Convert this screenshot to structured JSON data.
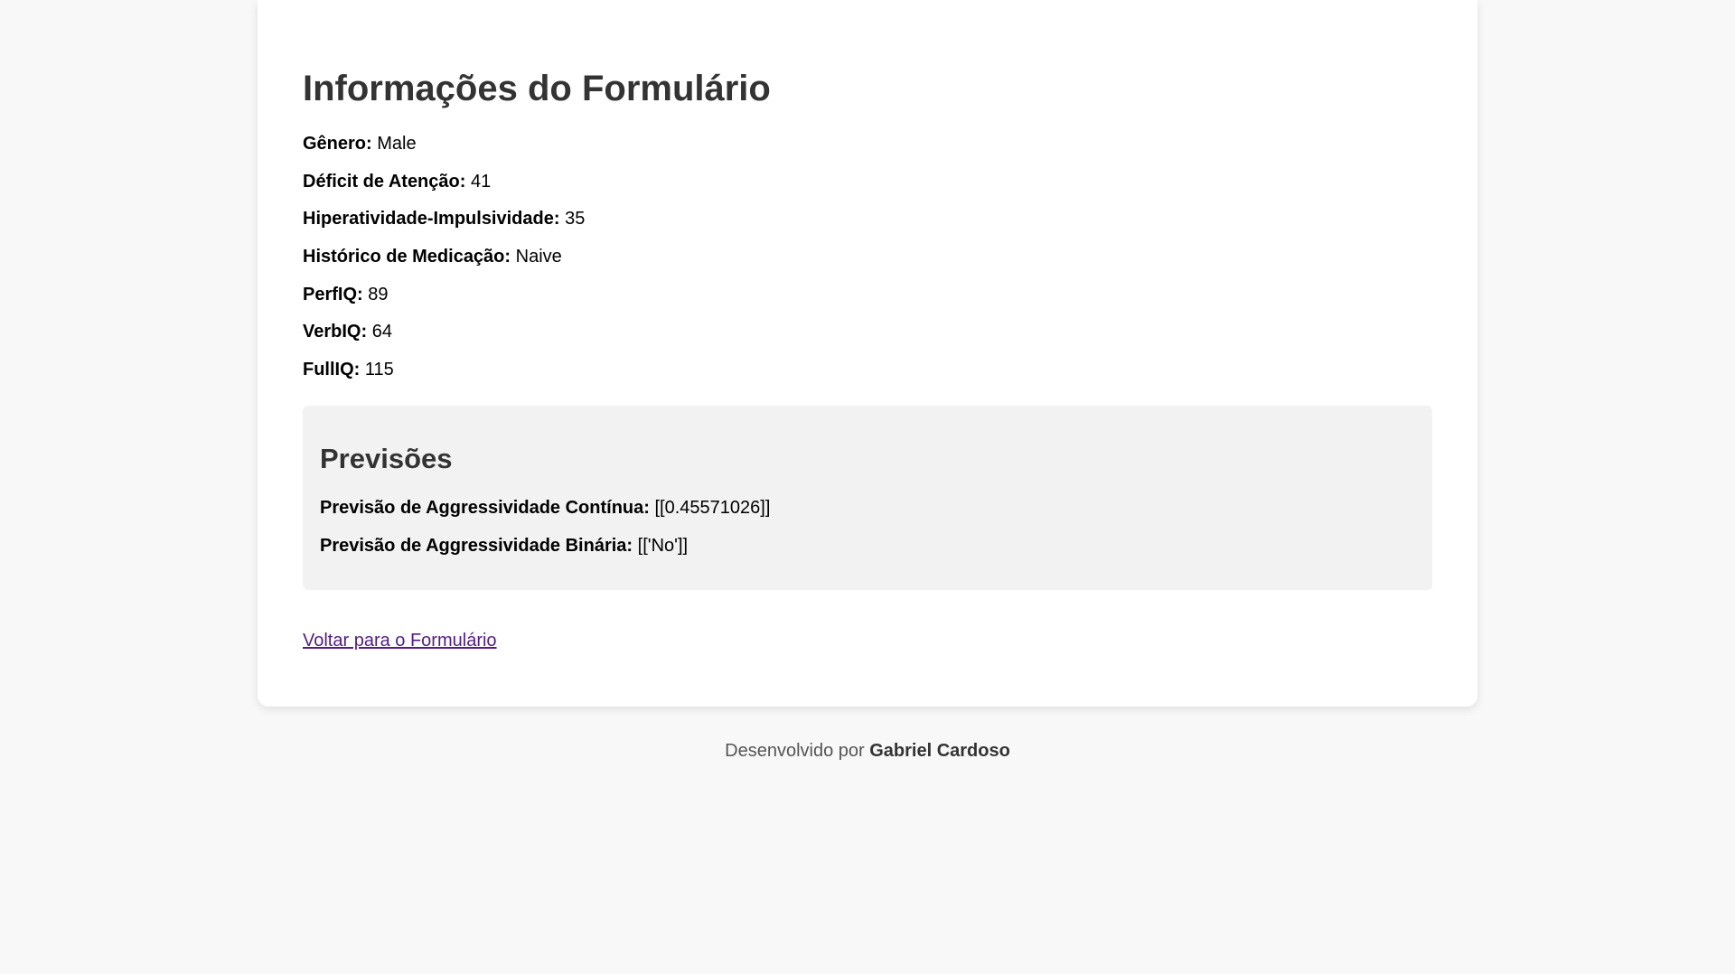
{
  "page": {
    "title": "Informações do Formulário"
  },
  "fields": [
    {
      "label": "Gênero:",
      "value": "Male"
    },
    {
      "label": "Déficit de Atenção:",
      "value": "41"
    },
    {
      "label": "Hiperatividade-Impulsividade:",
      "value": "35"
    },
    {
      "label": "Histórico de Medicação:",
      "value": "Naive"
    },
    {
      "label": "PerfIQ:",
      "value": "89"
    },
    {
      "label": "VerbIQ:",
      "value": "64"
    },
    {
      "label": "FullIQ:",
      "value": "115"
    }
  ],
  "predictions": {
    "title": "Previsões",
    "items": [
      {
        "label": "Previsão de Aggressividade Contínua:",
        "value": "[[0.45571026]]"
      },
      {
        "label": "Previsão de Aggressividade Binária:",
        "value": "[['No']]"
      }
    ]
  },
  "back_link": {
    "label": "Voltar para o Formulário"
  },
  "footer": {
    "prefix": "Desenvolvido por",
    "author": "Gabriel Cardoso"
  },
  "colors": {
    "background": "#f8f8f8",
    "card": "#ffffff",
    "predictions_panel": "#f2f2f2",
    "heading": "#333333",
    "link_visited": "#551a8b",
    "footer_text": "#555555"
  }
}
